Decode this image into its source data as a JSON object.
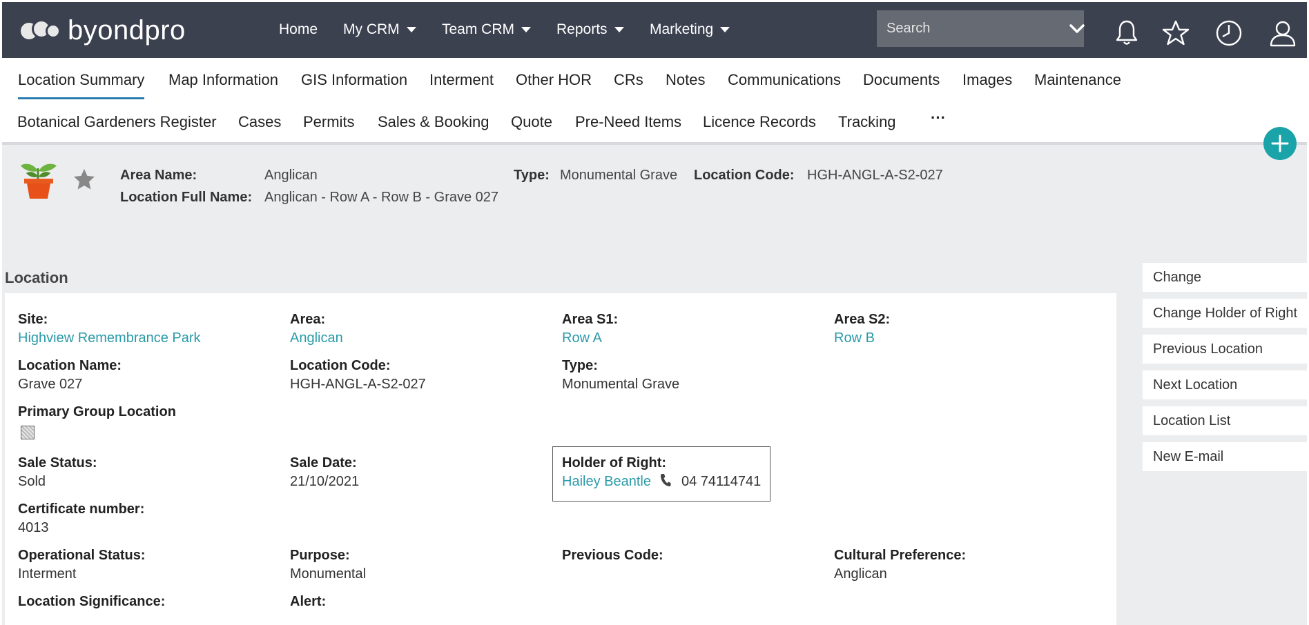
{
  "app": {
    "brand": "byondpro"
  },
  "topnav": {
    "items": [
      {
        "label": "Home",
        "dropdown": false
      },
      {
        "label": "My CRM",
        "dropdown": true
      },
      {
        "label": "Team CRM",
        "dropdown": true
      },
      {
        "label": "Reports",
        "dropdown": true
      },
      {
        "label": "Marketing",
        "dropdown": true
      }
    ],
    "search_placeholder": "Search",
    "icons": [
      "bell-icon",
      "star-icon",
      "clock-icon",
      "user-icon"
    ]
  },
  "tabs": {
    "row1": [
      "Location Summary",
      "Map Information",
      "GIS Information",
      "Interment",
      "Other HOR",
      "CRs",
      "Notes",
      "Communications",
      "Documents",
      "Images",
      "Maintenance"
    ],
    "row2": [
      "Botanical Gardeners Register",
      "Cases",
      "Permits",
      "Sales & Booking",
      "Quote",
      "Pre-Need Items",
      "Licence Records",
      "Tracking"
    ],
    "more": "···",
    "active": "Location Summary"
  },
  "summary": {
    "area_name_label": "Area Name:",
    "area_name": "Anglican",
    "full_name_label": "Location Full Name:",
    "full_name": "Anglican - Row A - Row B - Grave 027",
    "type_label": "Type:",
    "type": "Monumental Grave",
    "code_label": "Location Code:",
    "code": "HGH-ANGL-A-S2-027"
  },
  "location": {
    "title": "Location",
    "site_label": "Site:",
    "site": "Highview Remembrance Park",
    "area_label": "Area:",
    "area": "Anglican",
    "s1_label": "Area S1:",
    "s1": "Row A",
    "s2_label": "Area S2:",
    "s2": "Row B",
    "name_label": "Location Name:",
    "name": "Grave 027",
    "code_label": "Location Code:",
    "code": "HGH-ANGL-A-S2-027",
    "type_label": "Type:",
    "type": "Monumental Grave",
    "primary_group_label": "Primary Group Location",
    "sale_status_label": "Sale Status:",
    "sale_status": "Sold",
    "sale_date_label": "Sale Date:",
    "sale_date": "21/10/2021",
    "holder_label": "Holder of Right:",
    "holder_name": "Hailey Beantle",
    "holder_phone": "04 74114741",
    "cert_label": "Certificate number:",
    "cert": "4013",
    "op_status_label": "Operational Status:",
    "op_status": "Interment",
    "purpose_label": "Purpose:",
    "purpose": "Monumental",
    "prev_code_label": "Previous Code:",
    "cultural_label": "Cultural Preference:",
    "cultural": "Anglican",
    "significance_label": "Location Significance:",
    "alert_label": "Alert:"
  },
  "actions": [
    "Change",
    "Change Holder of Right",
    "Previous Location",
    "Next Location",
    "Location List",
    "New E-mail"
  ],
  "colors": {
    "nav_bg": "#3c4150",
    "link": "#2a9aa8",
    "accent": "#1aa3a8",
    "panel_bg": "#ecedef"
  }
}
